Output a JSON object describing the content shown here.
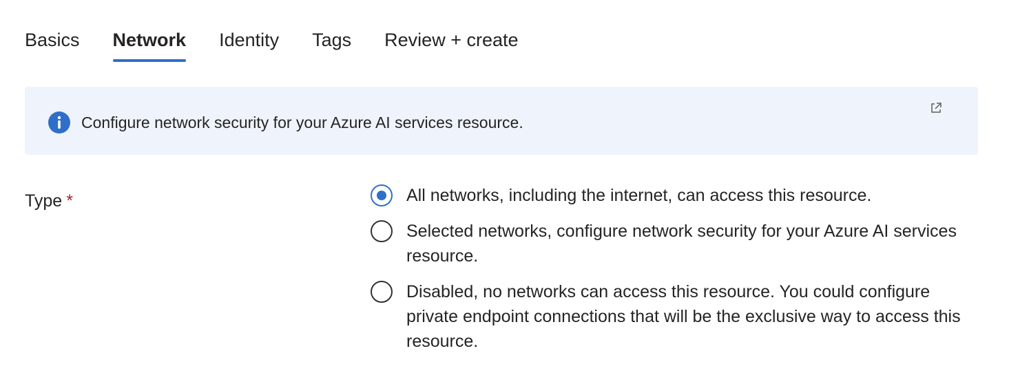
{
  "tabs": [
    {
      "label": "Basics",
      "active": false
    },
    {
      "label": "Network",
      "active": true
    },
    {
      "label": "Identity",
      "active": false
    },
    {
      "label": "Tags",
      "active": false
    },
    {
      "label": "Review + create",
      "active": false
    }
  ],
  "banner": {
    "icon": "info-icon",
    "text": "Configure network security for your Azure AI services resource.",
    "link_icon": "external-link-icon"
  },
  "type_field": {
    "label": "Type",
    "required_marker": "*",
    "options": [
      {
        "label": "All networks, including the internet, can access this resource.",
        "selected": true
      },
      {
        "label": "Selected networks, configure network security for your Azure AI services resource.",
        "selected": false
      },
      {
        "label": "Disabled, no networks can access this resource. You could configure private endpoint connections that will be the exclusive way to access this resource.",
        "selected": false
      }
    ]
  },
  "colors": {
    "accent": "#2f6fca",
    "banner_bg": "#eff4fc",
    "required": "#a4262c",
    "text": "#242424"
  }
}
